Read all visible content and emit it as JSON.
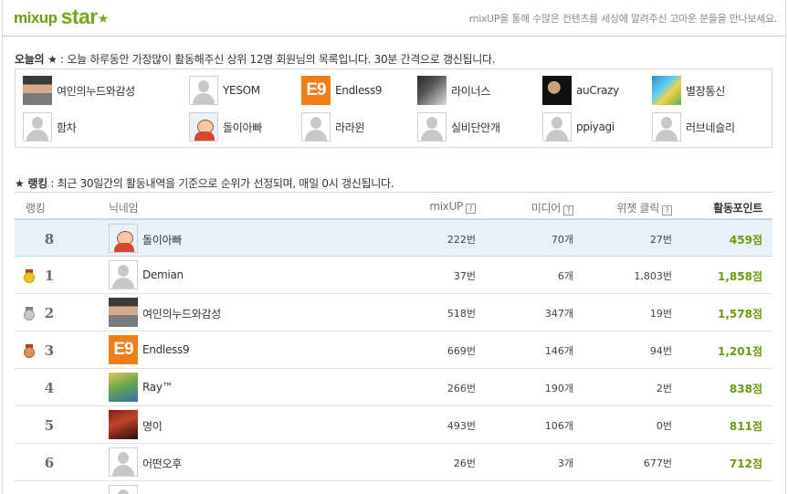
{
  "header": {
    "logo_text": "mixup",
    "logo_star": "star",
    "logo_star_icon": "★",
    "tagline": "mixUP을 통해 수많은 컨텐츠를 세상에 알려주신 고마운 분들을 만나보세요."
  },
  "today": {
    "title_bold": "오늘의 ★",
    "title_rest": " : 오늘 하루동안 가장많이 활동해주신 상위 12명 회원님의 목록입니다. 30분 간격으로 갱신됩니다.",
    "members": [
      {
        "name": "여인의누드와감성",
        "avatar": "photo1"
      },
      {
        "name": "YESOM",
        "avatar": "default"
      },
      {
        "name": "Endless9",
        "avatar": "e9"
      },
      {
        "name": "라이너스",
        "avatar": "photo2"
      },
      {
        "name": "auCrazy",
        "avatar": "photo3"
      },
      {
        "name": "별장통신",
        "avatar": "photo4"
      },
      {
        "name": "함차",
        "avatar": "default"
      },
      {
        "name": "돌이아빠",
        "avatar": "cartoon"
      },
      {
        "name": "라라윈",
        "avatar": "default"
      },
      {
        "name": "실비단안개",
        "avatar": "default"
      },
      {
        "name": "ppiyagi",
        "avatar": "default"
      },
      {
        "name": "러브네슬리",
        "avatar": "default"
      }
    ]
  },
  "ranking": {
    "title_bold": "★ 랭킹",
    "title_rest": " : 최근 30일간의 활동내역을 기준으로 순위가 선정되며, 매일 0시 갱신됩니다.",
    "headers": {
      "rank": "랭킹",
      "nickname": "닉네임",
      "mixup": "mixUP",
      "media": "미디어",
      "widget": "위젯 클릭",
      "points": "활동포인트",
      "help": "?"
    },
    "rows": [
      {
        "rank": "8",
        "medal": "",
        "nick": "돌이아빠",
        "avatar": "cartoon",
        "mixup": "222번",
        "media": "70개",
        "widget": "27번",
        "points": "459점",
        "highlight": true
      },
      {
        "rank": "1",
        "medal": "gold",
        "nick": "Demian",
        "avatar": "default",
        "mixup": "37번",
        "media": "6개",
        "widget": "1,803번",
        "points": "1,858점"
      },
      {
        "rank": "2",
        "medal": "silver",
        "nick": "여인의누드와감성",
        "avatar": "photo1",
        "mixup": "518번",
        "media": "347개",
        "widget": "19번",
        "points": "1,578점"
      },
      {
        "rank": "3",
        "medal": "bronze",
        "nick": "Endless9",
        "avatar": "e9",
        "mixup": "669번",
        "media": "146개",
        "widget": "94번",
        "points": "1,201점"
      },
      {
        "rank": "4",
        "medal": "",
        "nick": "Ray™",
        "avatar": "ray",
        "mixup": "266번",
        "media": "190개",
        "widget": "2번",
        "points": "838점"
      },
      {
        "rank": "5",
        "medal": "",
        "nick": "명이",
        "avatar": "myeong",
        "mixup": "493번",
        "media": "106개",
        "widget": "0번",
        "points": "811점"
      },
      {
        "rank": "6",
        "medal": "",
        "nick": "어떤오후",
        "avatar": "default",
        "mixup": "26번",
        "media": "3개",
        "widget": "677번",
        "points": "712점"
      },
      {
        "rank": "",
        "medal": "",
        "nick": "",
        "avatar": "default",
        "mixup": "",
        "media": "",
        "widget": "",
        "points": ""
      }
    ]
  }
}
